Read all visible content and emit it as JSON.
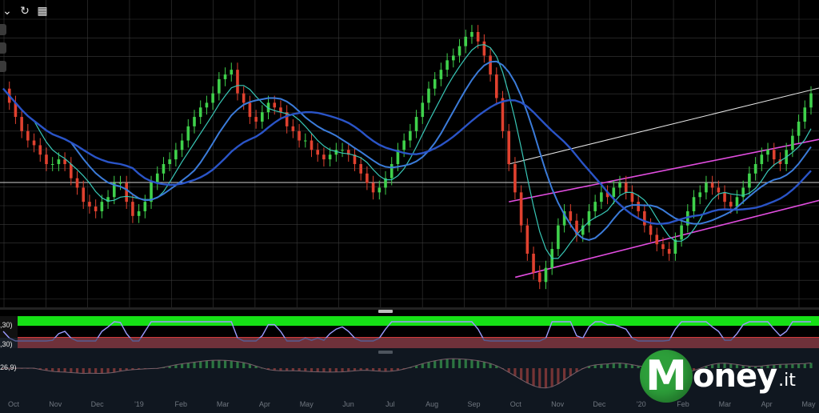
{
  "toolbar": {
    "icons": [
      "chevron-down-icon",
      "refresh-icon",
      "calendar-icon"
    ]
  },
  "indicators": {
    "rsi_top_label": ",30)",
    "rsi_bottom_label": ",30)",
    "macd_label": "26,9)"
  },
  "brand": {
    "initial": "M",
    "name": "oney",
    "tld": ".it"
  },
  "colors": {
    "background": "#000000",
    "grid": "#3a3a3a",
    "candle_up": "#3fd14b",
    "candle_down": "#e0412f",
    "ma_fast": "#38c7b6",
    "ma_medium": "#3b7bd9",
    "ma_slow": "#2a54c7",
    "channel": "#e24de0",
    "trendline": "#e8e8e8",
    "rsi_overbought": "#16e016",
    "rsi_oversold": "#d23a3a",
    "rsi_line": "#9b9bff",
    "brand_green": "#2d9f3a"
  },
  "chart_data": {
    "type": "line",
    "x_labels": [
      "Oct",
      "Nov",
      "Dec",
      "'19",
      "Feb",
      "Mar",
      "Apr",
      "May",
      "Jun",
      "Jul",
      "Aug",
      "Sep",
      "Oct",
      "Nov",
      "Dec",
      "'20",
      "Feb",
      "Mar",
      "Apr",
      "May"
    ],
    "x_index": [
      0,
      1,
      2,
      3,
      4,
      5,
      6,
      7,
      8,
      9,
      10,
      11,
      12,
      13,
      14,
      15,
      16,
      17,
      18,
      19
    ],
    "price_index": [
      0,
      0.25,
      0.5,
      0.75,
      1,
      1.25,
      1.5,
      1.75,
      2,
      2.25,
      2.5,
      2.75,
      3,
      3.25,
      3.5,
      3.75,
      4,
      4.25,
      4.5,
      4.75,
      5,
      5.25,
      5.5,
      5.75,
      6,
      6.25,
      6.5,
      6.75,
      7,
      7.25,
      7.5,
      7.75,
      8,
      8.25,
      8.5,
      8.75,
      9,
      9.25,
      9.5,
      9.75,
      10,
      10.25,
      10.5,
      10.75,
      11,
      11.25,
      11.5,
      11.75,
      12,
      12.25,
      12.5,
      12.75,
      13,
      13.25,
      13.5,
      13.75,
      14,
      14.25,
      14.5,
      14.75,
      15,
      15.25,
      15.5,
      15.75,
      16,
      16.25,
      16.5,
      16.75,
      17,
      17.25,
      17.5,
      17.75,
      18,
      18.25,
      18.5,
      18.75,
      19,
      19.25,
      19.5,
      19.75,
      20,
      20.25,
      20.5,
      20.75,
      21,
      21.25,
      21.5,
      21.75,
      22,
      22.25,
      22.5,
      22.75,
      23,
      23.25,
      23.5,
      23.75,
      24,
      24.25,
      24.5,
      24.75,
      25,
      25.25,
      25.5,
      25.75,
      26,
      26.25,
      26.5,
      26.75,
      27,
      27.25,
      27.5,
      27.75,
      28,
      28.25,
      28.5,
      28.75,
      29,
      29.25,
      29.5,
      29.75,
      30,
      30.25,
      30.5,
      30.75,
      31,
      31.25,
      31.5,
      31.75,
      32,
      32.25,
      32.5,
      32.75
    ],
    "price": [
      88,
      82,
      76,
      70,
      66,
      64,
      60,
      56,
      56,
      58,
      56,
      50,
      46,
      40,
      38,
      36,
      40,
      42,
      48,
      48,
      40,
      34,
      36,
      40,
      48,
      52,
      56,
      58,
      62,
      66,
      72,
      76,
      80,
      82,
      86,
      92,
      94,
      96,
      86,
      82,
      76,
      74,
      78,
      82,
      80,
      78,
      72,
      70,
      66,
      66,
      62,
      60,
      58,
      60,
      62,
      62,
      60,
      56,
      52,
      48,
      44,
      46,
      50,
      56,
      62,
      66,
      70,
      76,
      82,
      88,
      92,
      96,
      100,
      102,
      106,
      110,
      112,
      108,
      102,
      94,
      84,
      70,
      56,
      44,
      30,
      18,
      10,
      6,
      12,
      20,
      30,
      36,
      32,
      26,
      30,
      36,
      40,
      44,
      42,
      46,
      48,
      44,
      40,
      36,
      30,
      26,
      22,
      20,
      18,
      24,
      30,
      36,
      42,
      44,
      48,
      46,
      44,
      40,
      38,
      42,
      46,
      52,
      56,
      60,
      62,
      58,
      56,
      62,
      68,
      74,
      80,
      86,
      84,
      78
    ],
    "series": []
  }
}
